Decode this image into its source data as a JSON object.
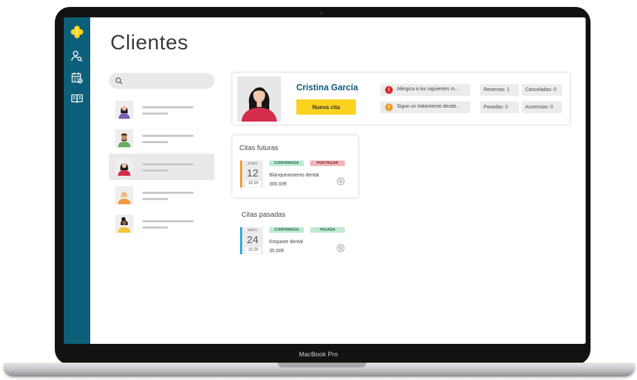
{
  "device": {
    "label": "MacBook Pro"
  },
  "sidebar": {
    "items": [
      {
        "icon": "health-cross-logo-icon"
      },
      {
        "icon": "user-search-icon"
      },
      {
        "icon": "calendar-check-icon"
      },
      {
        "icon": "book-icon"
      }
    ]
  },
  "page": {
    "title": "Clientes"
  },
  "client": {
    "name": "Cristina García",
    "new_appointment_label": "Nueva cita",
    "alerts": [
      {
        "text": "Alérgica a los siguientes m...",
        "icon": "exclamation-icon",
        "color": "#d8262f"
      },
      {
        "text": "Sigue un tratamiento desde...",
        "icon": "exclamation-icon",
        "color": "#f39a2a"
      }
    ],
    "stats": {
      "reservations": "Reservas: 1",
      "cancelled": "Canceladas: 0",
      "past": "Pasadas: 0",
      "absences": "Ausencias: 0"
    }
  },
  "future_appointments": {
    "title": "Citas futuras",
    "items": [
      {
        "month": "JUNIO",
        "day": "12",
        "time": "10:20",
        "status": "CONFIRMADA",
        "payment": "POR PAGAR",
        "service": "Blanqueamiento dental",
        "price": "300,00€",
        "accent": "#f39a2a"
      }
    ]
  },
  "past_appointments": {
    "title": "Citas pasadas",
    "items": [
      {
        "month": "MAYO",
        "day": "24",
        "time": "10:20",
        "status": "CONFIRMADA",
        "payment": "PAGADA",
        "service": "Empaste dental",
        "price": "35,00€",
        "accent": "#2aa8d8"
      }
    ]
  },
  "colors": {
    "sidebar": "#0d5f79",
    "brand_yellow": "#fbd31f",
    "name_blue": "#0f5a79",
    "confirmed_bg": "#bfead2",
    "unpaid_bg": "#f2b3b8",
    "paid_bg": "#bfead2"
  }
}
